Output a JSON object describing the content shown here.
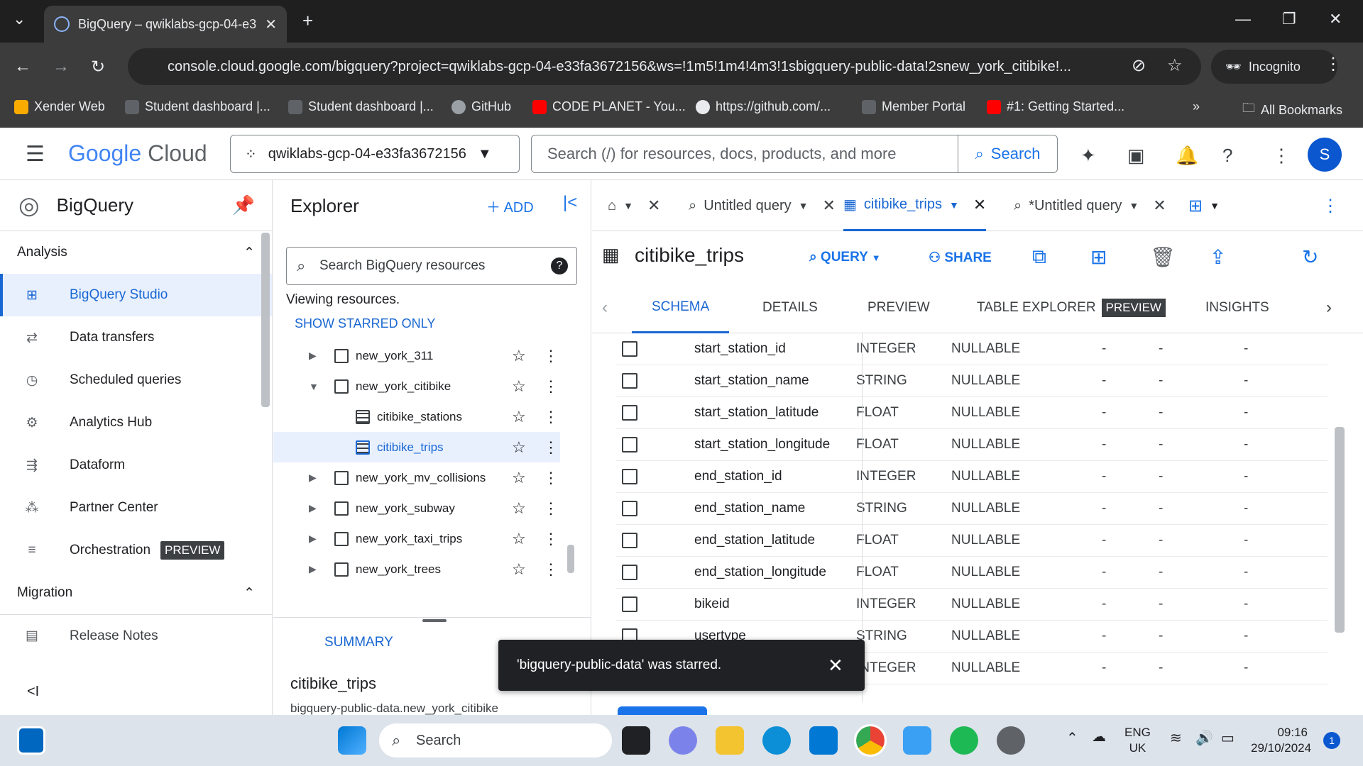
{
  "browser": {
    "tab_title": "BigQuery – qwiklabs-gcp-04-e3",
    "url": "console.cloud.google.com/bigquery?project=qwiklabs-gcp-04-e33fa3672156&ws=!1m5!1m4!4m3!1sbigquery-public-data!2snew_york_citibike!...",
    "incognito_label": "Incognito",
    "bookmarks": [
      "Xender Web",
      "Student dashboard |...",
      "Student dashboard |...",
      "GitHub",
      "CODE PLANET - You...",
      "https://github.com/...",
      "Member Portal",
      "#1: Getting Started..."
    ],
    "all_bookmarks": "All Bookmarks",
    "more": "»"
  },
  "header": {
    "logo_google": "Google",
    "logo_cloud": "Cloud",
    "project": "qwiklabs-gcp-04-e33fa3672156",
    "search_placeholder": "Search (/) for resources, docs, products, and more",
    "search_button": "Search",
    "avatar_letter": "S"
  },
  "leftnav": {
    "product": "BigQuery",
    "section_analysis": "Analysis",
    "items": [
      {
        "label": "BigQuery Studio"
      },
      {
        "label": "Data transfers"
      },
      {
        "label": "Scheduled queries"
      },
      {
        "label": "Analytics Hub"
      },
      {
        "label": "Dataform"
      },
      {
        "label": "Partner Center"
      },
      {
        "label": "Orchestration",
        "badge": "PREVIEW"
      }
    ],
    "section_migration": "Migration",
    "release_notes": "Release Notes",
    "collapse": "<I"
  },
  "explorer": {
    "title": "Explorer",
    "add": "ADD",
    "search_placeholder": "Search BigQuery resources",
    "viewing": "Viewing resources.",
    "show_starred": "SHOW STARRED ONLY",
    "tree": [
      {
        "label": "new_york_311",
        "level": 1,
        "expanded": false
      },
      {
        "label": "new_york_citibike",
        "level": 1,
        "expanded": true
      },
      {
        "label": "citibike_stations",
        "level": 2
      },
      {
        "label": "citibike_trips",
        "level": 2,
        "selected": true
      },
      {
        "label": "new_york_mv_collisions",
        "level": 1,
        "expanded": false
      },
      {
        "label": "new_york_subway",
        "level": 1,
        "expanded": false
      },
      {
        "label": "new_york_taxi_trips",
        "level": 1,
        "expanded": false
      },
      {
        "label": "new_york_trees",
        "level": 1,
        "expanded": false
      }
    ],
    "summary_tab": "SUMMARY",
    "summary_title": "citibike_trips",
    "summary_sub": "bigquery-public-data.new_york_citibike"
  },
  "main": {
    "tabs": [
      {
        "label": "Untitled query"
      },
      {
        "label": "citibike_trips",
        "active": true
      },
      {
        "label": "*Untitled query"
      }
    ],
    "table_name": "citibike_trips",
    "actions": {
      "query": "QUERY",
      "share": "SHARE"
    },
    "subtabs": [
      "SCHEMA",
      "DETAILS",
      "PREVIEW",
      "TABLE EXPLORER",
      "INSIGHTS"
    ],
    "subtab_badge": "PREVIEW",
    "schema_rows": [
      {
        "name": "start_station_id",
        "type": "INTEGER",
        "mode": "NULLABLE"
      },
      {
        "name": "start_station_name",
        "type": "STRING",
        "mode": "NULLABLE"
      },
      {
        "name": "start_station_latitude",
        "type": "FLOAT",
        "mode": "NULLABLE"
      },
      {
        "name": "start_station_longitude",
        "type": "FLOAT",
        "mode": "NULLABLE"
      },
      {
        "name": "end_station_id",
        "type": "INTEGER",
        "mode": "NULLABLE"
      },
      {
        "name": "end_station_name",
        "type": "STRING",
        "mode": "NULLABLE"
      },
      {
        "name": "end_station_latitude",
        "type": "FLOAT",
        "mode": "NULLABLE"
      },
      {
        "name": "end_station_longitude",
        "type": "FLOAT",
        "mode": "NULLABLE"
      },
      {
        "name": "bikeid",
        "type": "INTEGER",
        "mode": "NULLABLE"
      },
      {
        "name": "usertype",
        "type": "STRING",
        "mode": "NULLABLE"
      },
      {
        "name": "",
        "type": "INTEGER",
        "mode": "NULLABLE"
      }
    ],
    "dash": "-"
  },
  "toast": {
    "message": "'bigquery-public-data' was starred."
  },
  "taskbar": {
    "search": "Search",
    "lang_top": "ENG",
    "lang_bottom": "UK",
    "time": "09:16",
    "date": "29/10/2024",
    "notifications": "1"
  }
}
